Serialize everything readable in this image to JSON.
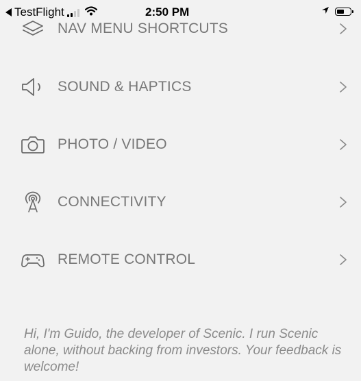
{
  "status_bar": {
    "back_app": "TestFlight",
    "time": "2:50 PM",
    "icons": [
      "back-arrow-icon",
      "cellular-signal-icon",
      "wifi-icon",
      "location-arrow-icon",
      "battery-icon"
    ]
  },
  "menu": {
    "items": [
      {
        "label": "NAV MENU SHORTCUTS",
        "icon": "layers-icon"
      },
      {
        "label": "SOUND & HAPTICS",
        "icon": "speaker-icon"
      },
      {
        "label": "PHOTO / VIDEO",
        "icon": "camera-icon"
      },
      {
        "label": "CONNECTIVITY",
        "icon": "antenna-icon"
      },
      {
        "label": "REMOTE CONTROL",
        "icon": "gamepad-icon"
      }
    ],
    "chevron": ">"
  },
  "footer": {
    "text": "Hi, I'm Guido, the developer of Scenic. I run Scenic alone, without backing from investors. Your feedback is welcome!"
  },
  "colors": {
    "background": "#f2f2f2",
    "text": "#777777",
    "footer_text": "#8a8a8a"
  }
}
